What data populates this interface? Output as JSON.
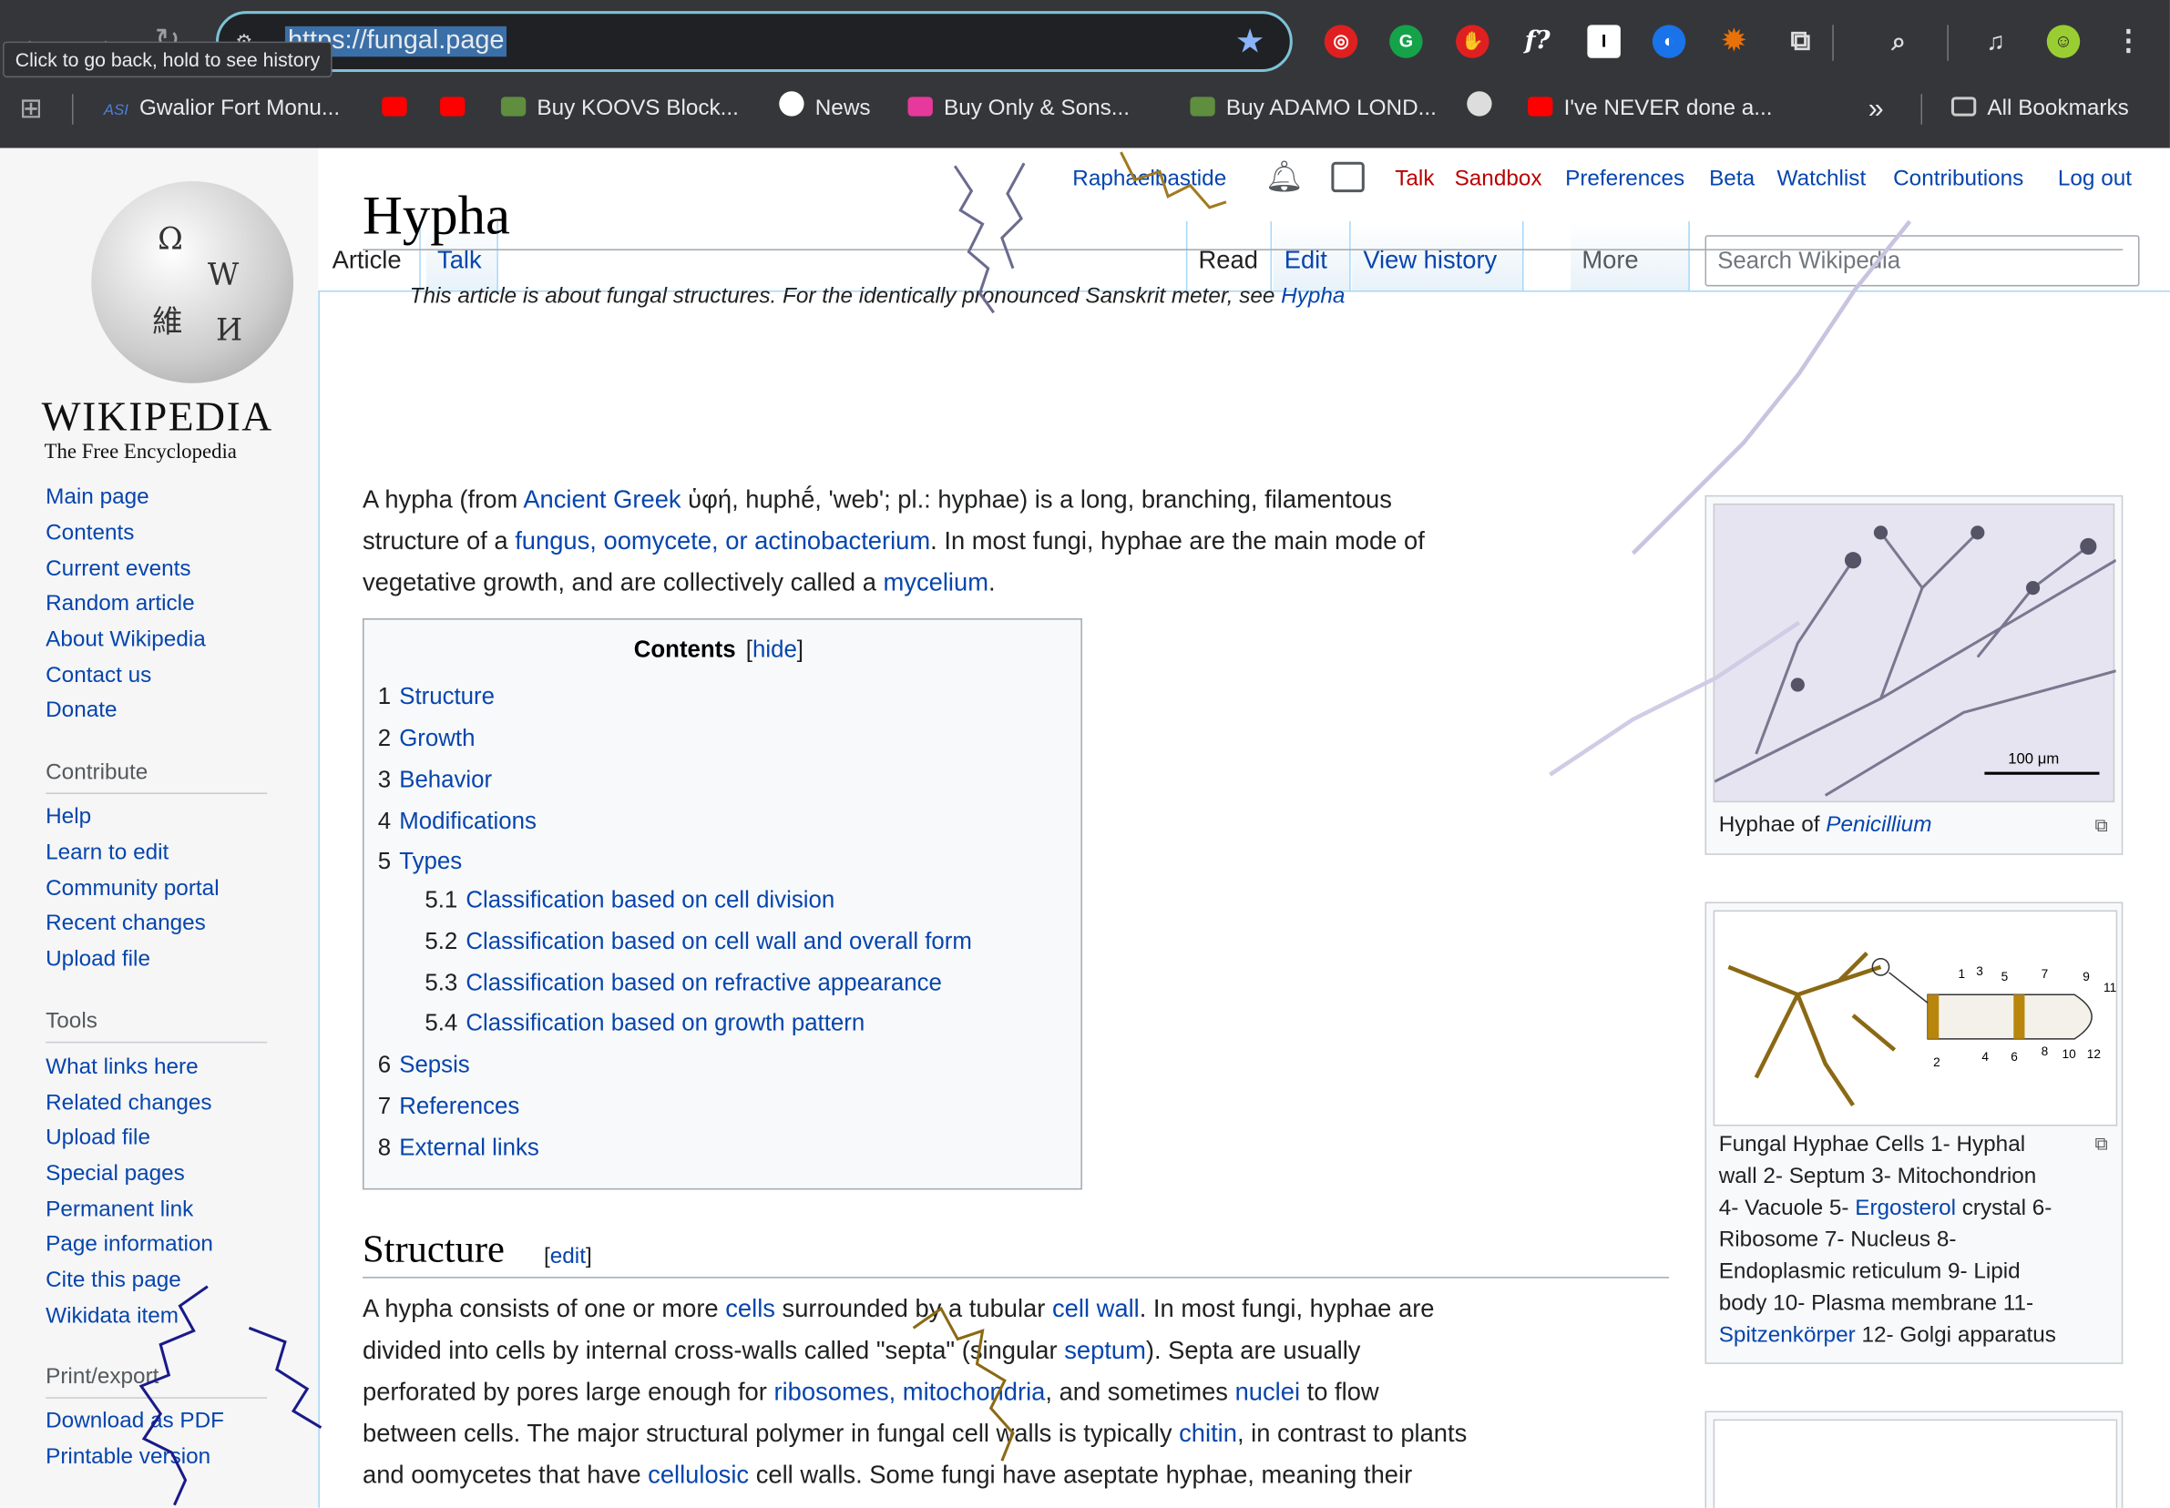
{
  "browser": {
    "url": "https://fungal.page",
    "tooltip": "Click to go back, hold to see history",
    "bookmarks": [
      "Gwalior Fort Monu...",
      "Buy KOOVS Block...",
      "News",
      "Buy Only & Sons...",
      "Buy ADAMO LOND...",
      "I've NEVER done a...",
      "All Bookmarks"
    ],
    "bookmark_prefix": "ASI",
    "ext_labels": [
      "f?",
      "I"
    ]
  },
  "logo": {
    "word": "WIKIPEDIA",
    "tagline": "The Free Encyclopedia"
  },
  "sidebar": {
    "nav": [
      "Main page",
      "Contents",
      "Current events",
      "Random article",
      "About Wikipedia",
      "Contact us",
      "Donate"
    ],
    "contribute_heading": "Contribute",
    "contribute": [
      "Help",
      "Learn to edit",
      "Community portal",
      "Recent changes",
      "Upload file"
    ],
    "tools_heading": "Tools",
    "tools": [
      "What links here",
      "Related changes",
      "Upload file",
      "Special pages",
      "Permanent link",
      "Page information",
      "Cite this page",
      "Wikidata item"
    ],
    "print_heading": "Print/export",
    "print": [
      "Download as PDF",
      "Printable version"
    ]
  },
  "user_bar": {
    "username": "Raphaelbastide",
    "links": [
      "Talk",
      "Sandbox",
      "Preferences",
      "Beta",
      "Watchlist",
      "Contributions",
      "Log out"
    ]
  },
  "tabs": {
    "article": "Article",
    "talk": "Talk",
    "read": "Read",
    "edit": "Edit",
    "history": "View history",
    "more": "More"
  },
  "search": {
    "placeholder": "Search Wikipedia"
  },
  "article": {
    "title": "Hypha",
    "hatnote": "This article is about fungal structures. For the identically pronounced Sanskrit meter, see",
    "hatnote_link": "Hypha",
    "intro": [
      {
        "pre": "A hypha (from ",
        "link": "Ancient Greek",
        "post": " ὑφή, huphḗ, 'web'; pl.: hyphae) is a long, branching, filamentous"
      },
      {
        "pre": "structure of a ",
        "link": "fungus, oomycete, or actinobacterium",
        "post": ". In most fungi, hyphae are the main mode of"
      },
      {
        "pre": "vegetative growth, and are collectively called a ",
        "link": "mycelium",
        "post": "."
      }
    ],
    "toc": {
      "title": "Contents",
      "hide": "hide",
      "items": [
        {
          "n": "1",
          "t": "Structure"
        },
        {
          "n": "2",
          "t": "Growth"
        },
        {
          "n": "3",
          "t": "Behavior"
        },
        {
          "n": "4",
          "t": "Modifications"
        },
        {
          "n": "5",
          "t": "Types"
        },
        {
          "n": "5.1",
          "t": "Classification based on cell division"
        },
        {
          "n": "5.2",
          "t": "Classification based on cell wall and overall form"
        },
        {
          "n": "5.3",
          "t": "Classification based on refractive appearance"
        },
        {
          "n": "5.4",
          "t": "Classification based on growth pattern"
        },
        {
          "n": "6",
          "t": "Sepsis"
        },
        {
          "n": "7",
          "t": "References"
        },
        {
          "n": "8",
          "t": "External links"
        }
      ]
    },
    "structure_heading": "Structure",
    "edit_label": "edit",
    "structure_lines": [
      {
        "pre": "A hypha consists of one or more ",
        "link": "cells",
        "mid": " surrounded by a tubular ",
        "link2": "cell wall",
        "post": ". In most fungi, hyphae are"
      },
      {
        "pre": "divided into cells by internal cross-walls called \"septa\" (singular ",
        "link": "septum",
        "mid": "). Septa are usually",
        "link2": "",
        "post": ""
      },
      {
        "pre": "perforated by pores large enough for ",
        "link": "ribosomes, mitochondria",
        "mid": ", and sometimes ",
        "link2": "nuclei",
        "post": " to flow"
      },
      {
        "pre": "between cells. The major structural polymer in fungal cell walls is typically ",
        "link": "chitin",
        "mid": ", in contrast to plants",
        "link2": "",
        "post": ""
      },
      {
        "pre": "and oomycetes that have ",
        "link": "cellulosic",
        "mid": " cell walls. Some fungi have aseptate hyphae, meaning their",
        "link2": "",
        "post": ""
      }
    ]
  },
  "figures": {
    "fig1_caption_pre": "Hyphae of ",
    "fig1_caption_link": "Penicillium",
    "fig1_scale": "100 μm",
    "fig2_caption_a": "Fungal Hyphae Cells 1- Hyphal",
    "fig2_caption_b": "wall 2- Septum 3- Mitochondrion",
    "fig2_caption_c_pre": "4- Vacuole 5- ",
    "fig2_caption_c_link": "Ergosterol",
    "fig2_caption_c_post": " crystal 6-",
    "fig2_caption_d": "Ribosome 7- Nucleus 8-",
    "fig2_caption_e": "Endoplasmic reticulum 9- Lipid",
    "fig2_caption_f": "body 10- Plasma membrane 11-",
    "fig2_caption_g_link": "Spitzenkörper",
    "fig2_caption_g_post": " 12- Golgi apparatus",
    "fig2_numbers": [
      "1",
      "3",
      "5",
      "7",
      "9",
      "11",
      "2",
      "4",
      "6",
      "8",
      "10",
      "12"
    ]
  }
}
